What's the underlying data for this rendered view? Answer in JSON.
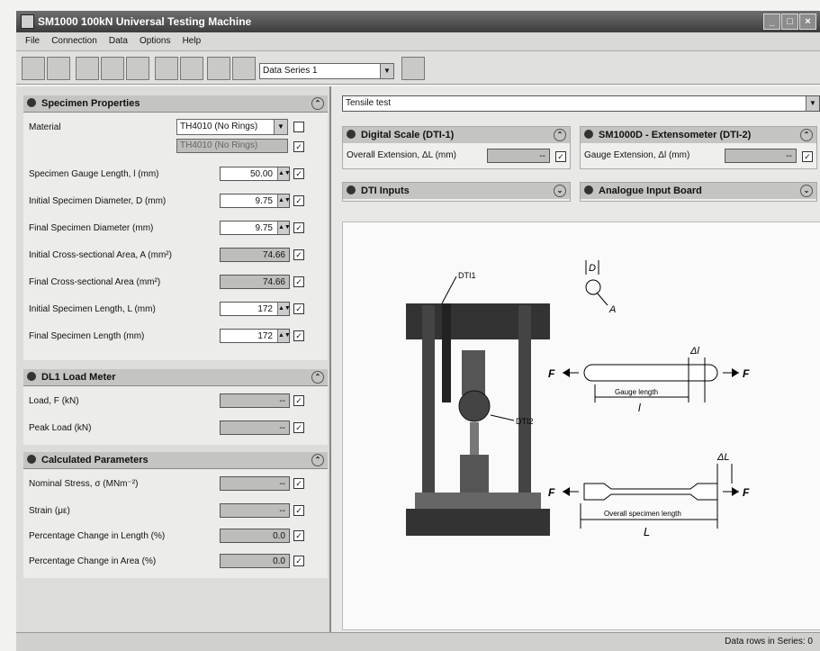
{
  "window": {
    "title": "SM1000 100kN Universal Testing Machine"
  },
  "menu": [
    "File",
    "Connection",
    "Data",
    "Options",
    "Help"
  ],
  "toolbar": {
    "series_select": "Data Series 1"
  },
  "specimen": {
    "header": "Specimen Properties",
    "material_label": "Material",
    "material_value": "TH4010 (No Rings)",
    "material_sub": "TH4010 (No Rings)",
    "rows": [
      {
        "label": "Specimen Gauge Length, l  (mm)",
        "value": "50.00"
      },
      {
        "label": "Initial Specimen Diameter, D  (mm)",
        "value": "9.75"
      },
      {
        "label": "Final Specimen Diameter  (mm)",
        "value": "9.75"
      },
      {
        "label": "Initial Cross-sectional Area, A  (mm²)",
        "value": "74.66"
      },
      {
        "label": "Final Cross-sectional Area  (mm²)",
        "value": "74.66"
      },
      {
        "label": "Initial Specimen Length, L  (mm)",
        "value": "172"
      },
      {
        "label": "Final Specimen Length  (mm)",
        "value": "172"
      }
    ]
  },
  "loadmeter": {
    "header": "DL1 Load Meter",
    "rows": [
      {
        "label": "Load, F  (kN)",
        "value": "--"
      },
      {
        "label": "Peak Load  (kN)",
        "value": "--"
      }
    ]
  },
  "calc": {
    "header": "Calculated Parameters",
    "rows": [
      {
        "label": "Nominal Stress, σ  (MNm⁻²)",
        "value": "--"
      },
      {
        "label": "Strain  (με)",
        "value": "--"
      },
      {
        "label": "Percentage Change in Length  (%)",
        "value": "0.0"
      },
      {
        "label": "Percentage Change in Area  (%)",
        "value": "0.0"
      }
    ]
  },
  "test_select": "Tensile test",
  "dti1": {
    "header": "Digital Scale (DTI-1)",
    "label": "Overall Extension, ΔL  (mm)",
    "value": "--"
  },
  "ext": {
    "header": "SM1000D - Extensometer (DTI-2)",
    "label": "Gauge Extension, Δl  (mm)",
    "value": "--"
  },
  "dti_inputs": {
    "header": "DTI Inputs"
  },
  "analogue": {
    "header": "Analogue Input Board"
  },
  "diagram": {
    "dti1": "DTI1",
    "dti2": "DTI2",
    "d": "D",
    "a": "A",
    "f": "F",
    "dl_small": "Δl",
    "dl_big": "ΔL",
    "gauge": "Gauge length",
    "l_small": "l",
    "overall": "Overall specimen length",
    "l_big": "L"
  },
  "status": {
    "rows": "Data rows in Series: 0"
  }
}
